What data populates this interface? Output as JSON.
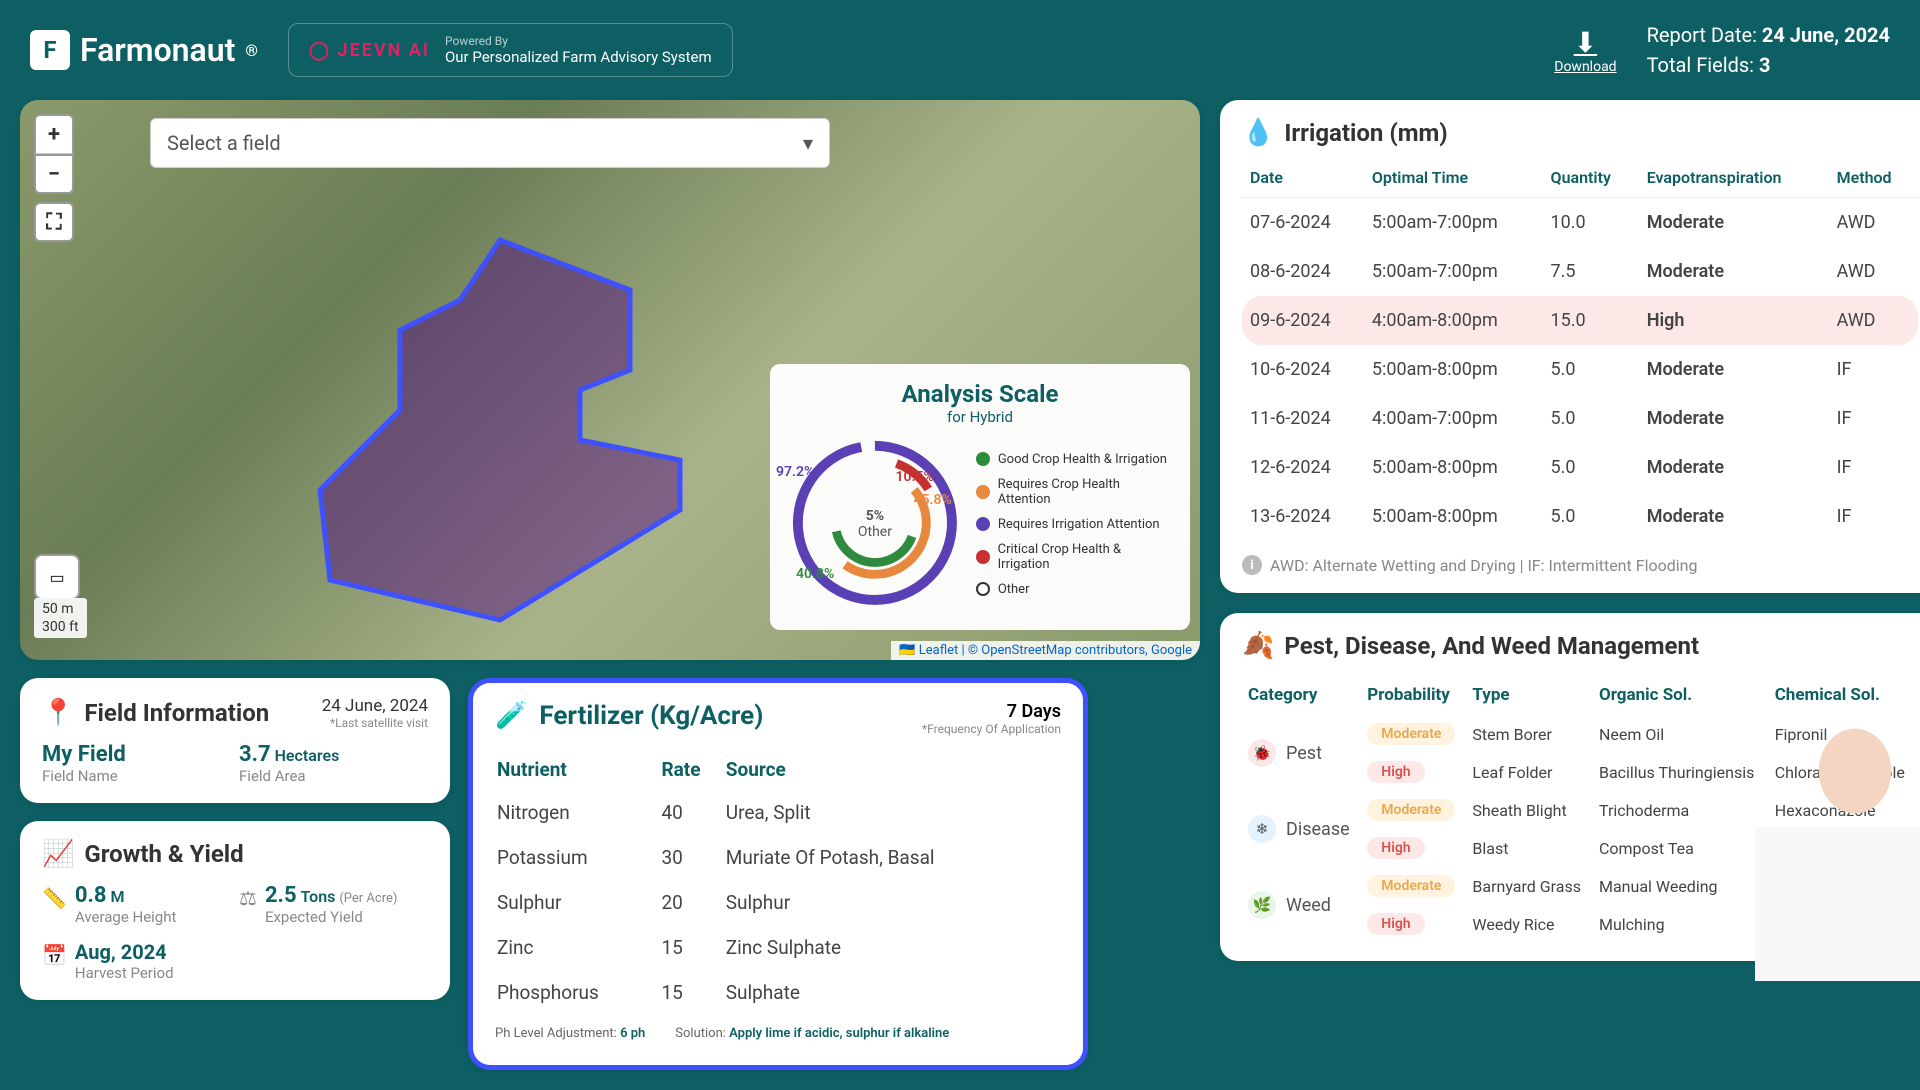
{
  "header": {
    "brand": "Farmonaut",
    "trademark": "®",
    "jeevn_logo": "JEEVN AI",
    "jeevn_powered": "Powered By",
    "jeevn_sub": "Our Personalized Farm Advisory System",
    "download": "Download",
    "report_date_label": "Report Date:",
    "report_date": "24 June, 2024",
    "total_fields_label": "Total Fields:",
    "total_fields": "3"
  },
  "map": {
    "select_placeholder": "Select a field",
    "scale_m": "50 m",
    "scale_ft": "300 ft",
    "attrib": "🇺🇦 Leaflet | © OpenStreetMap contributors, Google",
    "analysis": {
      "title": "Analysis Scale",
      "subtitle": "for Hybrid",
      "center_pct": "5%",
      "center_lbl": "Other",
      "labels": {
        "a": "97.2%",
        "b": "10.5%",
        "c": "45.8%",
        "d": "40.8%"
      },
      "legend": [
        {
          "color": "#2e8b3e",
          "label": "Good Crop Health & Irrigation"
        },
        {
          "color": "#e8883e",
          "label": "Requires Crop Health Attention"
        },
        {
          "color": "#5a3fb5",
          "label": "Requires Irrigation Attention"
        },
        {
          "color": "#c73030",
          "label": "Critical Crop Health & Irrigation"
        },
        {
          "color": "#ffffff",
          "label": "Other",
          "border": true
        }
      ]
    }
  },
  "field_info": {
    "title": "Field Information",
    "date": "24 June, 2024",
    "date_sub": "*Last satellite visit",
    "name_val": "My Field",
    "name_lbl": "Field Name",
    "area_val": "3.7",
    "area_unit": "Hectares",
    "area_lbl": "Field Area"
  },
  "growth": {
    "title": "Growth & Yield",
    "height_val": "0.8",
    "height_unit": "M",
    "height_lbl": "Average Height",
    "yield_val": "2.5",
    "yield_unit": "Tons",
    "yield_per": "(Per Acre)",
    "yield_lbl": "Expected Yield",
    "harvest_val": "Aug, 2024",
    "harvest_lbl": "Harvest Period"
  },
  "fertilizer": {
    "title": "Fertilizer (Kg/Acre)",
    "days": "7 Days",
    "freq": "*Frequency Of Application",
    "cols": {
      "nutrient": "Nutrient",
      "rate": "Rate",
      "source": "Source"
    },
    "rows": [
      {
        "n": "Nitrogen",
        "r": "40",
        "s": "Urea, Split"
      },
      {
        "n": "Potassium",
        "r": "30",
        "s": "Muriate Of Potash, Basal"
      },
      {
        "n": "Sulphur",
        "r": "20",
        "s": "Sulphur"
      },
      {
        "n": "Zinc",
        "r": "15",
        "s": "Zinc Sulphate"
      },
      {
        "n": "Phosphorus",
        "r": "15",
        "s": "Sulphate"
      }
    ],
    "ph_label": "Ph Level Adjustment:",
    "ph_val": "6 ph",
    "sol_label": "Solution:",
    "sol_val": "Apply lime if acidic, sulphur if alkaline"
  },
  "irrigation": {
    "title": "Irrigation (mm)",
    "cols": {
      "date": "Date",
      "time": "Optimal Time",
      "qty": "Quantity",
      "evap": "Evapotranspiration",
      "method": "Method"
    },
    "rows": [
      {
        "d": "07-6-2024",
        "t": "5:00am-7:00pm",
        "q": "10.0",
        "e": "Moderate",
        "m": "AWD",
        "high": false
      },
      {
        "d": "08-6-2024",
        "t": "5:00am-7:00pm",
        "q": "7.5",
        "e": "Moderate",
        "m": "AWD",
        "high": false
      },
      {
        "d": "09-6-2024",
        "t": "4:00am-8:00pm",
        "q": "15.0",
        "e": "High",
        "m": "AWD",
        "high": true
      },
      {
        "d": "10-6-2024",
        "t": "5:00am-8:00pm",
        "q": "5.0",
        "e": "Moderate",
        "m": "IF",
        "high": false
      },
      {
        "d": "11-6-2024",
        "t": "4:00am-7:00pm",
        "q": "5.0",
        "e": "Moderate",
        "m": "IF",
        "high": false
      },
      {
        "d": "12-6-2024",
        "t": "5:00am-8:00pm",
        "q": "5.0",
        "e": "Moderate",
        "m": "IF",
        "high": false
      },
      {
        "d": "13-6-2024",
        "t": "5:00am-8:00pm",
        "q": "5.0",
        "e": "Moderate",
        "m": "IF",
        "high": false
      }
    ],
    "footer": "AWD: Alternate Wetting and Drying | IF: Intermittent Flooding"
  },
  "pest": {
    "title": "Pest, Disease, And Weed Management",
    "cols": {
      "cat": "Category",
      "prob": "Probability",
      "type": "Type",
      "org": "Organic Sol.",
      "chem": "Chemical Sol."
    },
    "cats": [
      {
        "icon": "🐞",
        "bg": "#fde8e8",
        "name": "Pest",
        "rows": [
          {
            "p": "Moderate",
            "t": "Stem Borer",
            "o": "Neem Oil",
            "c": "Fipronil"
          },
          {
            "p": "High",
            "t": "Leaf Folder",
            "o": "Bacillus Thuringiensis",
            "c": "Chlorantraniliprole"
          }
        ]
      },
      {
        "icon": "❄",
        "bg": "#e3f2fd",
        "name": "Disease",
        "rows": [
          {
            "p": "Moderate",
            "t": "Sheath Blight",
            "o": "Trichoderma",
            "c": "Hexaconazole"
          },
          {
            "p": "High",
            "t": "Blast",
            "o": "Compost Tea",
            "c": ""
          }
        ]
      },
      {
        "icon": "🌿",
        "bg": "#e8f5e9",
        "name": "Weed",
        "rows": [
          {
            "p": "Moderate",
            "t": "Barnyard Grass",
            "o": "Manual Weeding",
            "c": ""
          },
          {
            "p": "High",
            "t": "Weedy Rice",
            "o": "Mulching",
            "c": ""
          }
        ]
      }
    ]
  },
  "chart_data": {
    "type": "pie",
    "title": "Analysis Scale for Hybrid",
    "series": [
      {
        "name": "Good Crop Health & Irrigation",
        "value": 40.8,
        "color": "#2e8b3e"
      },
      {
        "name": "Requires Crop Health Attention",
        "value": 45.8,
        "color": "#e8883e"
      },
      {
        "name": "Requires Irrigation Attention",
        "value": 97.2,
        "color": "#5a3fb5"
      },
      {
        "name": "Critical Crop Health & Irrigation",
        "value": 10.5,
        "color": "#c73030"
      },
      {
        "name": "Other",
        "value": 5,
        "color": "#ffffff"
      }
    ],
    "note": "Concentric donut rings; percentages are ring fill, not parts of 100"
  }
}
